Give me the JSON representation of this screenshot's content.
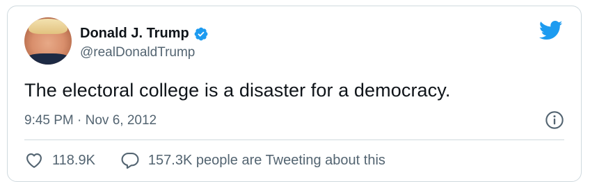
{
  "author": {
    "display_name": "Donald J. Trump",
    "handle": "@realDonaldTrump",
    "verified": true
  },
  "tweet": {
    "text": "The electoral college is a disaster for a democracy.",
    "timestamp": "9:45 PM · Nov 6, 2012"
  },
  "actions": {
    "likes_count": "118.9K",
    "conversation_text": "157.3K people are Tweeting about this"
  },
  "icons": {
    "brand": "twitter-bird-icon",
    "verified": "verified-badge-icon",
    "info": "info-icon",
    "like": "heart-icon",
    "reply": "speech-bubble-icon"
  },
  "colors": {
    "brand_blue": "#1d9bf0",
    "text_primary": "#0f1419",
    "text_secondary": "#536471",
    "border": "#cfd9de"
  }
}
